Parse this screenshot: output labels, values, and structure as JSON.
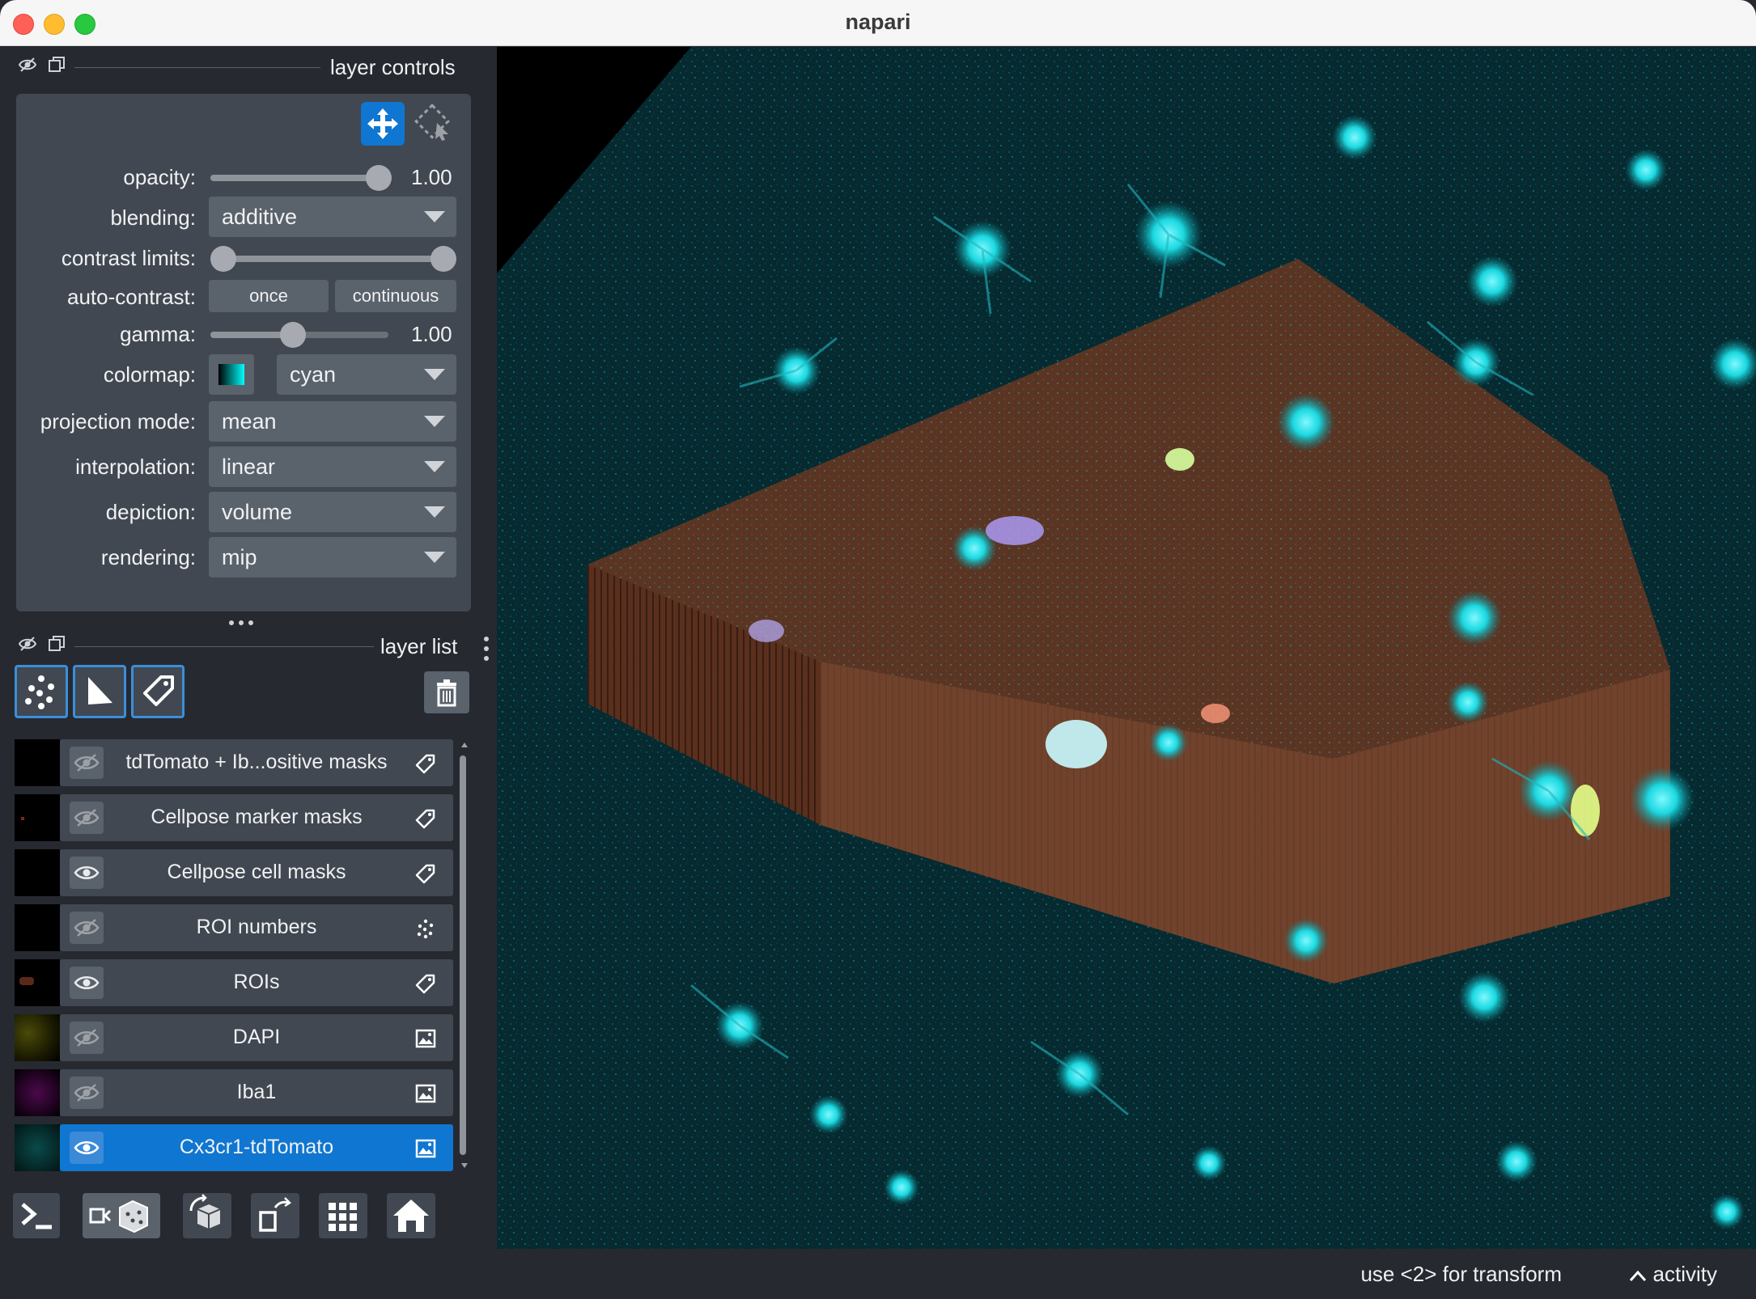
{
  "window": {
    "title": "napari"
  },
  "layer_controls": {
    "title": "layer controls",
    "opacity": {
      "label": "opacity:",
      "value": "1.00",
      "level": 1.0
    },
    "blending": {
      "label": "blending:",
      "value": "additive"
    },
    "contrast_limits": {
      "label": "contrast limits:"
    },
    "auto_contrast": {
      "label": "auto-contrast:",
      "once": "once",
      "continuous": "continuous"
    },
    "gamma": {
      "label": "gamma:",
      "value": "1.00"
    },
    "colormap": {
      "label": "colormap:",
      "value": "cyan"
    },
    "projection_mode": {
      "label": "projection mode:",
      "value": "mean"
    },
    "interpolation": {
      "label": "interpolation:",
      "value": "linear"
    },
    "depiction": {
      "label": "depiction:",
      "value": "volume"
    },
    "rendering": {
      "label": "rendering:",
      "value": "mip"
    }
  },
  "layer_list": {
    "title": "layer list",
    "layers": [
      {
        "name": "tdTomato + Ib...ositive masks",
        "type": "labels-icon",
        "visible": false
      },
      {
        "name": "Cellpose marker masks",
        "type": "labels-icon",
        "visible": false
      },
      {
        "name": "Cellpose cell masks",
        "type": "labels-icon",
        "visible": true
      },
      {
        "name": "ROI numbers",
        "type": "points-icon",
        "visible": false
      },
      {
        "name": "ROIs",
        "type": "labels-icon",
        "visible": true
      },
      {
        "name": "DAPI",
        "type": "image-icon",
        "visible": false
      },
      {
        "name": "Iba1",
        "type": "image-icon",
        "visible": false
      },
      {
        "name": "Cx3cr1-tdTomato",
        "type": "image-icon",
        "visible": true,
        "selected": true
      }
    ]
  },
  "status": {
    "message": "use <2> for transform",
    "activity": "activity"
  },
  "colors": {
    "accent": "#0f76d1",
    "panel": "#414851",
    "background": "#262930",
    "cyan": "#00ffff"
  }
}
